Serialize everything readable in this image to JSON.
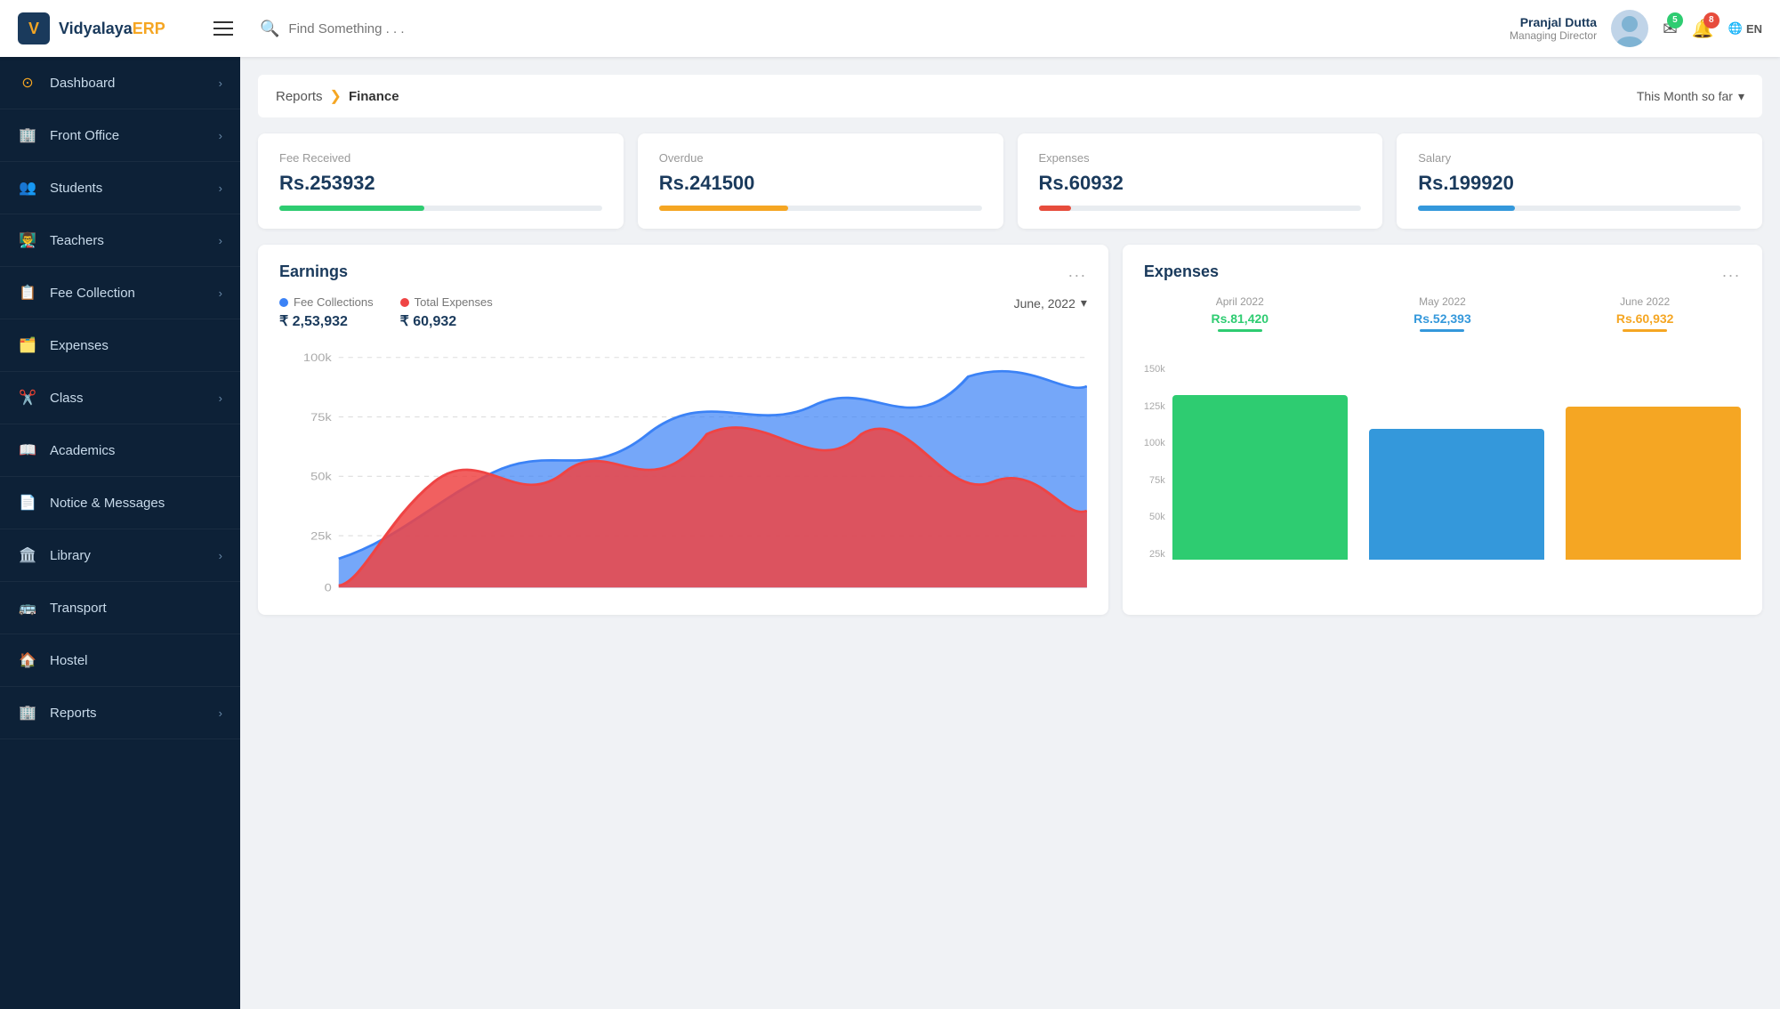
{
  "app": {
    "name": "VidyalayaERP",
    "name_colored": "Vidyalaya",
    "name_suffix": "ERP"
  },
  "topnav": {
    "search_placeholder": "Find Something . . .",
    "user_name": "Pranjal Dutta",
    "user_role": "Managing Director",
    "mail_badge": "5",
    "notif_badge": "8",
    "lang": "EN",
    "chevron": "▾"
  },
  "sidebar": {
    "items": [
      {
        "id": "dashboard",
        "label": "Dashboard",
        "icon": "⊙",
        "has_arrow": true
      },
      {
        "id": "front-office",
        "label": "Front Office",
        "icon": "🏢",
        "has_arrow": true
      },
      {
        "id": "students",
        "label": "Students",
        "icon": "👥",
        "has_arrow": true
      },
      {
        "id": "teachers",
        "label": "Teachers",
        "icon": "👨‍🏫",
        "has_arrow": true
      },
      {
        "id": "fee-collection",
        "label": "Fee Collection",
        "icon": "📋",
        "has_arrow": true
      },
      {
        "id": "expenses",
        "label": "Expenses",
        "icon": "🗂️",
        "has_arrow": false
      },
      {
        "id": "class",
        "label": "Class",
        "icon": "✂️",
        "has_arrow": true
      },
      {
        "id": "academics",
        "label": "Academics",
        "icon": "📖",
        "has_arrow": false
      },
      {
        "id": "notice-messages",
        "label": "Notice & Messages",
        "icon": "📄",
        "has_arrow": false
      },
      {
        "id": "library",
        "label": "Library",
        "icon": "🏛️",
        "has_arrow": true
      },
      {
        "id": "transport",
        "label": "Transport",
        "icon": "🚌",
        "has_arrow": false
      },
      {
        "id": "hostel",
        "label": "Hostel",
        "icon": "🏠",
        "has_arrow": false
      },
      {
        "id": "reports",
        "label": "Reports",
        "icon": "🏢",
        "has_arrow": true
      }
    ]
  },
  "breadcrumb": {
    "parent": "Reports",
    "current": "Finance",
    "separator": "❯"
  },
  "filter": {
    "label": "This Month so far",
    "chevron": "▾"
  },
  "stats": [
    {
      "id": "fee-received",
      "label": "Fee Received",
      "value": "Rs.253932",
      "progress": 45,
      "color": "#2ecc71"
    },
    {
      "id": "overdue",
      "label": "Overdue",
      "value": "Rs.241500",
      "progress": 40,
      "color": "#f5a623"
    },
    {
      "id": "expenses",
      "label": "Expenses",
      "value": "Rs.60932",
      "progress": 10,
      "color": "#e74c3c"
    },
    {
      "id": "salary",
      "label": "Salary",
      "value": "Rs.199920",
      "progress": 30,
      "color": "#3498db"
    }
  ],
  "earnings_chart": {
    "title": "Earnings",
    "legend": [
      {
        "id": "fee-collections",
        "label": "Fee Collections",
        "color": "#3b82f6",
        "value": "₹ 2,53,932"
      },
      {
        "id": "total-expenses",
        "label": "Total Expenses",
        "color": "#ef4444",
        "value": "₹ 60,932"
      }
    ],
    "month_selector": "June, 2022",
    "y_labels": [
      "100k",
      "75k",
      "50k",
      "25k",
      "0"
    ],
    "dots_label": "..."
  },
  "expenses_chart": {
    "title": "Expenses",
    "dots_label": "...",
    "months": [
      {
        "label": "April 2022",
        "value": "Rs.81,420",
        "color": "#2ecc71"
      },
      {
        "label": "May 2022",
        "value": "Rs.52,393",
        "color": "#3498db"
      },
      {
        "label": "June 2022",
        "value": "Rs.60,932",
        "color": "#f5a623"
      }
    ],
    "y_labels": [
      "150k",
      "125k",
      "100k",
      "75k",
      "50k",
      "25k"
    ],
    "bars": [
      {
        "height_pct": 84,
        "color": "#2ecc71"
      },
      {
        "height_pct": 67,
        "color": "#3498db"
      },
      {
        "height_pct": 78,
        "color": "#f5a623"
      }
    ]
  }
}
